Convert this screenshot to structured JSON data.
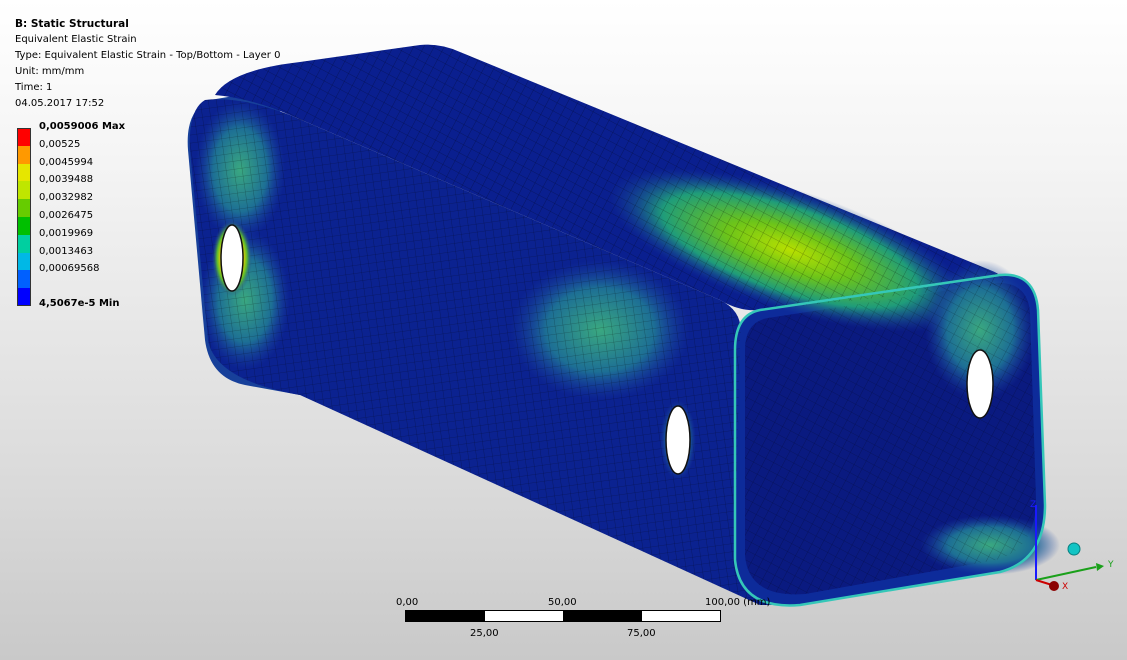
{
  "header": {
    "title": "B: Static Structural",
    "result_name": "Equivalent Elastic Strain",
    "type_line": "Type: Equivalent Elastic Strain - Top/Bottom - Layer 0",
    "unit_line": "Unit: mm/mm",
    "time_line": "Time: 1",
    "date_line": "04.05.2017 17:52"
  },
  "legend": [
    {
      "label": "0,0059006 Max",
      "color": "#ff0000",
      "bold": true
    },
    {
      "label": "0,00525",
      "color": "#ff9900"
    },
    {
      "label": "0,0045994",
      "color": "#e6e600"
    },
    {
      "label": "0,0039488",
      "color": "#bfe600"
    },
    {
      "label": "0,0032982",
      "color": "#66cc00"
    },
    {
      "label": "0,0026475",
      "color": "#00bf00"
    },
    {
      "label": "0,0019969",
      "color": "#00cfa0"
    },
    {
      "label": "0,0013463",
      "color": "#00b8e6"
    },
    {
      "label": "0,00069568",
      "color": "#0060ff"
    },
    {
      "label": "4,5067e-5 Min",
      "color": "#0000ff",
      "bold": true,
      "last": true
    }
  ],
  "scale": {
    "top_labels": [
      "0,00",
      "50,00",
      "100,00 (mm)"
    ],
    "bottom_labels": [
      "25,00",
      "75,00"
    ]
  },
  "triad": {
    "axis_y": "Y",
    "axis_x": "X",
    "axis_z": "Z"
  },
  "colors": {
    "min_blue": "#0a1f8f",
    "mesh_line": "#000000"
  }
}
